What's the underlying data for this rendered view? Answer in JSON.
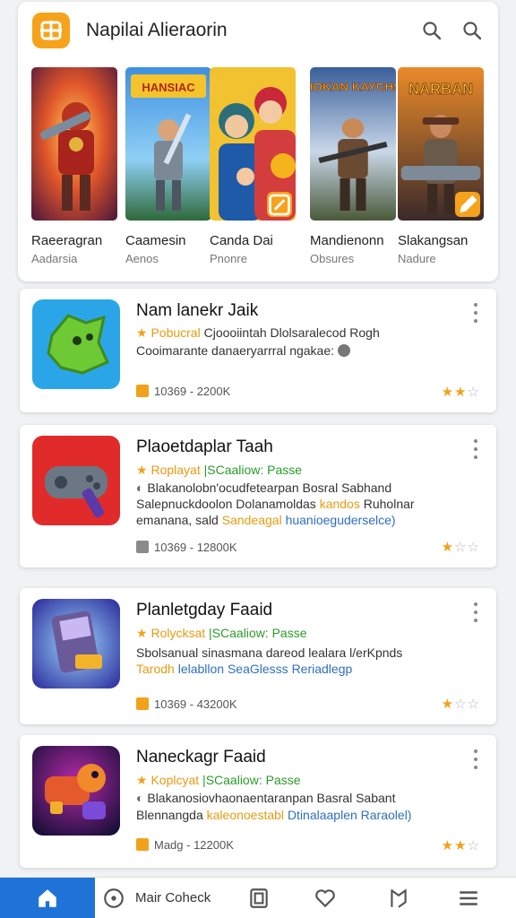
{
  "header": {
    "title": "Napilai Alieraorin",
    "logo_icon": "grid-logo-icon",
    "actions": [
      {
        "icon": "search-icon"
      },
      {
        "icon": "search-icon"
      }
    ]
  },
  "featured": [
    {
      "name": "Raeeragran",
      "sub": "Aadarsia"
    },
    {
      "name": "Caamesin",
      "sub": "Aenos"
    },
    {
      "name": "Canda Dai",
      "sub": "Pnonre"
    },
    {
      "name": "Mandienonn",
      "sub": "Obsures"
    },
    {
      "name": "Slakangsan",
      "sub": "Nadure"
    }
  ],
  "featured_titles": [
    "HANSIAC",
    "HOKAN KAYCHS",
    "NARBAN"
  ],
  "apps": [
    {
      "title": "Nam lanekr Jaik",
      "line1": "Pobucral",
      "line1_rest": "Cjoooiintah Dlolsaralecod Rogh",
      "line2": "Cooimarante danaeryarrral ngakae:",
      "meta": "10369 - 2200K",
      "rating": 2.5
    },
    {
      "title": "Plaoetdaplar Taah",
      "tag1": "Roplayat",
      "tag2": "SCaaliow: Passe",
      "line1": "Blakanolobn'ocudfetearpan Bosral Sabhand",
      "line2a": "Salepnuckdoolon Dolanamoldas",
      "line2b": "kandos",
      "line2c": "Ruholnar",
      "line3a": "emanana, sald",
      "line3b": "Sandeagal",
      "line3c": "huanioeguderselce)",
      "meta": "10369 - 12800K",
      "rating": 1.5
    },
    {
      "title": "Planletgday Faaid",
      "tag1": "Rolycksat",
      "tag2": "SCaaliow: Passe",
      "line1": "Sbolsanual sinasmana dareod lealara l/erKpnds",
      "line2a": "Tarodh",
      "line2b": "lelabllon SeaGlesss",
      "line2c": "Reriadlegp",
      "meta": "10369 - 43200K",
      "rating": 1
    },
    {
      "title": "Naneckagr Faaid",
      "tag1": "Koplcyat",
      "tag2": "SCaaliow: Passe",
      "line1": "Blakanosiovhaonaentaranpan Basral Sabant",
      "line2a": "Blennangda",
      "line2b": "kaleonoestabl",
      "line2c": "Dtinalaaplen Raraolel)",
      "meta": "Madg - 12200K",
      "rating": 1.5
    }
  ],
  "bottom_nav": {
    "label": "Mair Coheck",
    "items": [
      "home-icon",
      "compass-icon",
      "library-icon",
      "bookmark-square-icon",
      "heart-icon",
      "flag-icon",
      "menu-icon"
    ]
  },
  "colors": {
    "accent": "#f7a21b",
    "primary": "#1f73d6"
  }
}
